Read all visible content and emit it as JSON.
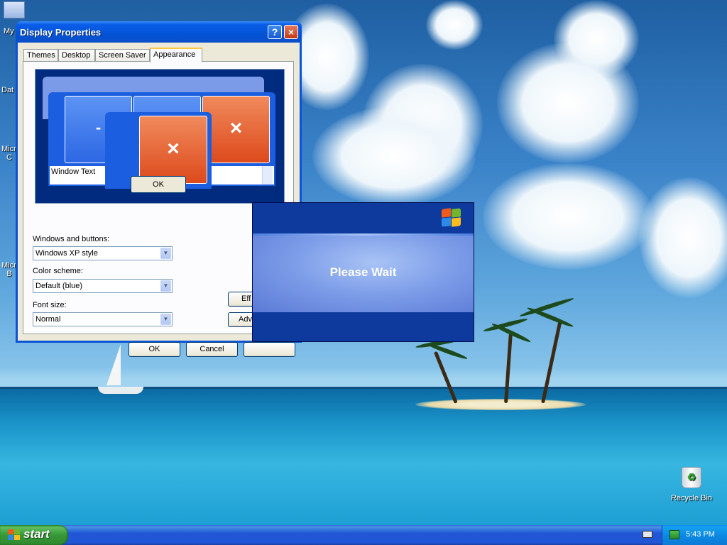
{
  "desktop": {
    "icons": [
      {
        "label": "My"
      },
      {
        "label": "Dat"
      },
      {
        "label": "Micro C"
      },
      {
        "label": "Micro B"
      },
      {
        "label": "Recycle Bin"
      }
    ]
  },
  "dialog": {
    "title": "Display Properties",
    "help_button": "?",
    "close_button": "×",
    "tabs": [
      {
        "label": "Themes",
        "active": false
      },
      {
        "label": "Desktop",
        "active": false
      },
      {
        "label": "Screen Saver",
        "active": false
      },
      {
        "label": "Appearance",
        "active": true
      }
    ],
    "preview": {
      "minimize_glyph": "-",
      "close_glyph": "×",
      "window_text": "Window Text",
      "ok_label": "OK"
    },
    "windows_buttons": {
      "label": "Windows and buttons:",
      "value": "Windows XP style"
    },
    "color_scheme": {
      "label": "Color scheme:",
      "value": "Default (blue)"
    },
    "font_size": {
      "label": "Font size:",
      "value": "Normal"
    },
    "effects_label": "Eff",
    "advanced_label": "Adv",
    "ok_label": "OK",
    "cancel_label": "Cancel"
  },
  "please_wait": {
    "message": "Please Wait"
  },
  "taskbar": {
    "start_label": "start",
    "clock": "5:43 PM"
  },
  "colors": {
    "xp_blue": "#0a53d6",
    "start_green": "#379837",
    "close_red": "#c33a14"
  }
}
